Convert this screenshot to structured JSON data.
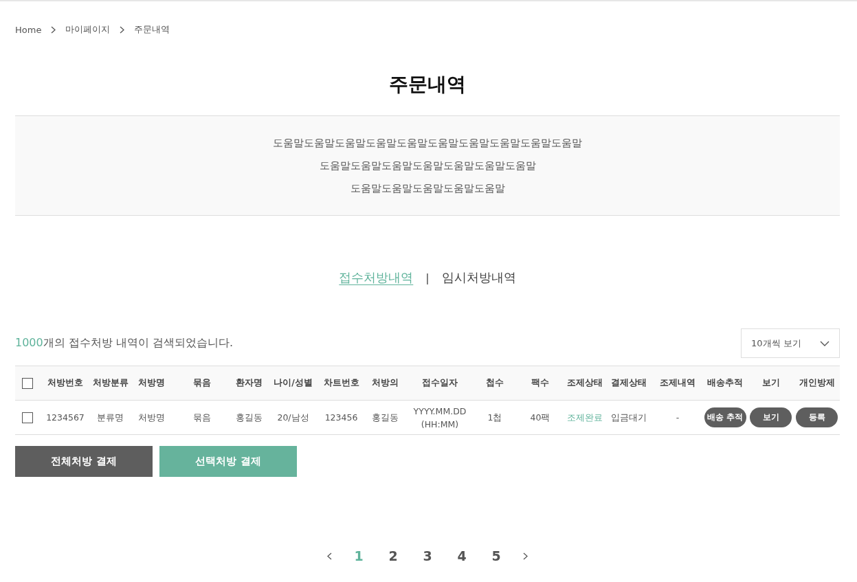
{
  "breadcrumb": [
    "Home",
    "마이페이지",
    "주문내역"
  ],
  "title": "주문내역",
  "help_lines": [
    "도움말도움말도움말도움말도움말도움말도움말도움말도움말도움말",
    "도움말도움말도움말도움말도움말도움말도움말",
    "도움말도움말도움말도움말도움말"
  ],
  "tabs": [
    {
      "label": "접수처방내역",
      "selected": true
    },
    {
      "label": "임시처방내역",
      "selected": false
    }
  ],
  "tab_separator": "|",
  "result": {
    "count": "1000",
    "text": "개의 접수처방 내역이 검색되었습니다."
  },
  "page_size_select": {
    "value": "10개씩 보기"
  },
  "table": {
    "header_checkbox": {
      "checked": false
    },
    "columns": [
      "처방번호",
      "처방분류",
      "처방명",
      "묶음",
      "환자명",
      "나이/성별",
      "차트번호",
      "처방의",
      "접수일자",
      "첩수",
      "팩수",
      "조제상태",
      "결제상태",
      "조제내역",
      "배송추적",
      "보기",
      "개인방제"
    ],
    "rows": [
      {
        "checked": false,
        "cells": [
          {
            "kind": "text",
            "text": "1234567"
          },
          {
            "kind": "text",
            "text": "분류명"
          },
          {
            "kind": "text",
            "text": "처방명"
          },
          {
            "kind": "text",
            "text": "묶음"
          },
          {
            "kind": "text",
            "text": "홍길동"
          },
          {
            "kind": "text",
            "text": "20/남성"
          },
          {
            "kind": "text",
            "text": "123456"
          },
          {
            "kind": "text",
            "text": "홍길동"
          },
          {
            "kind": "multiline",
            "lines": [
              "YYYY.MM.DD",
              "(HH:MM)"
            ]
          },
          {
            "kind": "text",
            "text": "1첩"
          },
          {
            "kind": "text",
            "text": "40팩"
          },
          {
            "kind": "status",
            "text": "조제완료"
          },
          {
            "kind": "text",
            "text": "입금대기"
          },
          {
            "kind": "text",
            "text": "-"
          },
          {
            "kind": "button",
            "text": "배송 추적"
          },
          {
            "kind": "button",
            "text": "보기"
          },
          {
            "kind": "button",
            "text": "등록"
          }
        ]
      }
    ]
  },
  "actions": [
    {
      "label": "전체처방 결제",
      "kind": "dark"
    },
    {
      "label": "선택처방 결제",
      "kind": "green"
    }
  ],
  "pagination": {
    "pages": [
      {
        "label": "1",
        "selected": true
      },
      {
        "label": "2",
        "selected": false
      },
      {
        "label": "3",
        "selected": false
      },
      {
        "label": "4",
        "selected": false
      },
      {
        "label": "5",
        "selected": false
      }
    ]
  }
}
